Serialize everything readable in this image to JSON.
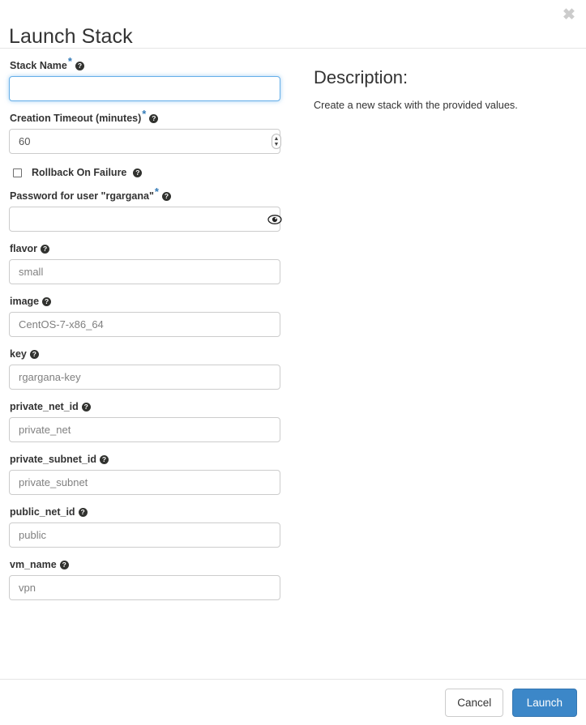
{
  "modal": {
    "title": "Launch Stack",
    "close_label": "✖"
  },
  "description": {
    "heading": "Description:",
    "text": "Create a new stack with the provided values."
  },
  "help_glyph": "?",
  "required_glyph": "*",
  "form": {
    "stack_name": {
      "label": "Stack Name",
      "required": true,
      "value": "",
      "placeholder": "",
      "focused": true
    },
    "creation_timeout": {
      "label": "Creation Timeout (minutes)",
      "required": true,
      "value": "60",
      "placeholder": ""
    },
    "rollback_on_failure": {
      "label": "Rollback On Failure",
      "checked": false
    },
    "password": {
      "label": "Password for user \"rgargana\"",
      "required": true,
      "value": "",
      "placeholder": "",
      "reveal_icon": "eye-icon"
    },
    "flavor": {
      "label": "flavor",
      "value": "",
      "placeholder": "small"
    },
    "image": {
      "label": "image",
      "value": "",
      "placeholder": "CentOS-7-x86_64"
    },
    "key": {
      "label": "key",
      "value": "",
      "placeholder": "rgargana-key"
    },
    "private_net_id": {
      "label": "private_net_id",
      "value": "",
      "placeholder": "private_net"
    },
    "private_subnet_id": {
      "label": "private_subnet_id",
      "value": "",
      "placeholder": "private_subnet"
    },
    "public_net_id": {
      "label": "public_net_id",
      "value": "",
      "placeholder": "public"
    },
    "vm_name": {
      "label": "vm_name",
      "value": "",
      "placeholder": "vpn"
    }
  },
  "footer": {
    "cancel_label": "Cancel",
    "launch_label": "Launch"
  },
  "colors": {
    "primary": "#3c87c8",
    "required_star": "#337ab7",
    "focus_border": "#66afe9",
    "border": "#cccccc",
    "text": "#333333"
  }
}
